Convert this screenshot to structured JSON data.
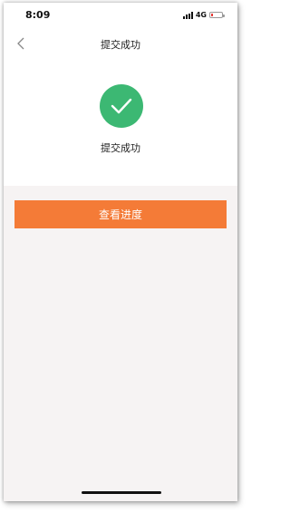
{
  "status_bar": {
    "time": "8:09",
    "network": "4G",
    "battery_level": 0.1
  },
  "nav": {
    "title": "提交成功",
    "back_icon": "chevron-left-icon"
  },
  "success": {
    "icon": "check-circle-icon",
    "icon_color": "#3cb873",
    "message": "提交成功"
  },
  "actions": {
    "view_progress_label": "查看进度",
    "button_color": "#f47b37"
  }
}
